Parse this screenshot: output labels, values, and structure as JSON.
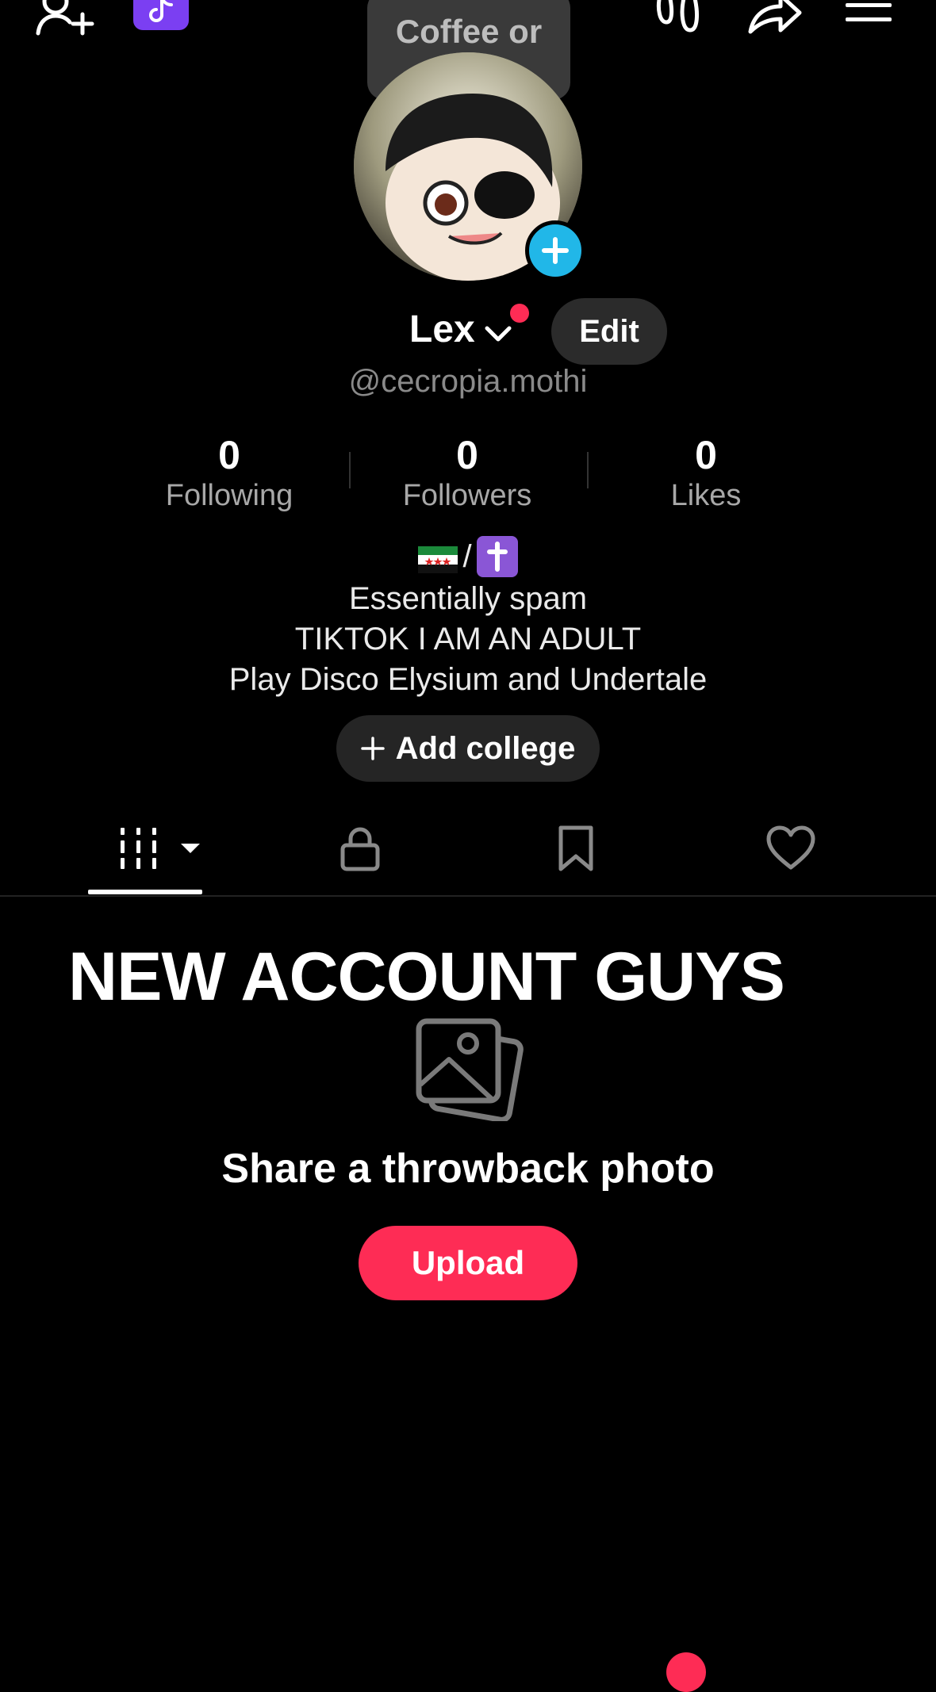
{
  "note": {
    "text": "Coffee or tea?"
  },
  "profile": {
    "display_name": "Lex",
    "username": "@cecropia.mothi",
    "edit_label": "Edit"
  },
  "stats": [
    {
      "value": "0",
      "label": "Following"
    },
    {
      "value": "0",
      "label": "Followers"
    },
    {
      "value": "0",
      "label": "Likes"
    }
  ],
  "bio": {
    "lines": [
      "Essentially spam",
      "TIKTOK I AM AN ADULT",
      "Play Disco Elysium and Undertale"
    ],
    "emoji_separator": "/"
  },
  "add_college_label": "Add college",
  "tabs": {
    "items": [
      "videos-grid-icon",
      "lock-icon",
      "bookmark-icon",
      "heart-icon"
    ],
    "active": 0
  },
  "content": {
    "banner_text": "NEW ACCOUNT GUYS",
    "empty_title": "Share a throwback photo",
    "upload_label": "Upload"
  },
  "colors": {
    "accent": "#fe2c55",
    "avatar_add": "#21b7e8",
    "tiktok_badge": "#7b3ff2"
  }
}
